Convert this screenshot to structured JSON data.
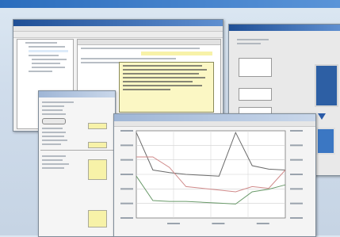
{
  "desktop": {
    "topbar_color": "#2b6dbd",
    "background_color": "#cfdceb"
  },
  "windows": {
    "config_window": {
      "title": "",
      "color": "#1f4f96"
    },
    "side_panel": {
      "title": "",
      "color": "#1f4f96"
    },
    "properties_window": {
      "title": ""
    },
    "chart_window": {
      "title": ""
    }
  },
  "chart_data": {
    "type": "line",
    "title": "",
    "xlabel": "",
    "ylabel": "",
    "series": [
      {
        "values": [
          0.98,
          0.55,
          0.52,
          0.5,
          0.49,
          0.48,
          0.98,
          0.6,
          0.56,
          0.55
        ]
      },
      {
        "values": [
          0.7,
          0.7,
          0.58,
          0.36,
          0.34,
          0.32,
          0.3,
          0.36,
          0.34,
          0.55
        ]
      },
      {
        "values": [
          0.48,
          0.2,
          0.19,
          0.19,
          0.18,
          0.17,
          0.16,
          0.3,
          0.33,
          0.38
        ]
      }
    ],
    "colors": [
      "#6a6a6a",
      "#d08a8a",
      "#6a9a6a"
    ]
  }
}
